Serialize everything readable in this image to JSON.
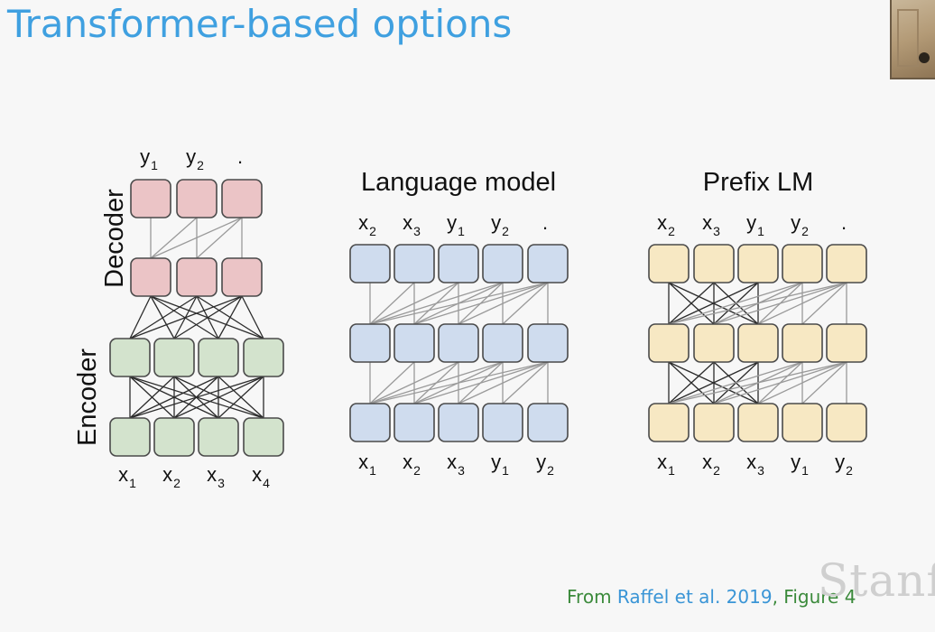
{
  "slide": {
    "title": "Transformer-based options"
  },
  "encoder_decoder": {
    "decoder_label": "Decoder",
    "encoder_label": "Encoder",
    "outputs": [
      {
        "base": "y",
        "sub": "1"
      },
      {
        "base": "y",
        "sub": "2"
      },
      {
        "base": ".",
        "sub": ""
      }
    ],
    "inputs": [
      {
        "base": "x",
        "sub": "1"
      },
      {
        "base": "x",
        "sub": "2"
      },
      {
        "base": "x",
        "sub": "3"
      },
      {
        "base": "x",
        "sub": "4"
      }
    ],
    "colors": {
      "decoder": "#ebc4c6",
      "encoder": "#d3e3cd"
    }
  },
  "language_model": {
    "title": "Language model",
    "outputs": [
      {
        "base": "x",
        "sub": "2"
      },
      {
        "base": "x",
        "sub": "3"
      },
      {
        "base": "y",
        "sub": "1"
      },
      {
        "base": "y",
        "sub": "2"
      },
      {
        "base": ".",
        "sub": ""
      }
    ],
    "inputs": [
      {
        "base": "x",
        "sub": "1"
      },
      {
        "base": "x",
        "sub": "2"
      },
      {
        "base": "x",
        "sub": "3"
      },
      {
        "base": "y",
        "sub": "1"
      },
      {
        "base": "y",
        "sub": "2"
      }
    ],
    "color": "#cfdcee"
  },
  "prefix_lm": {
    "title": "Prefix LM",
    "outputs": [
      {
        "base": "x",
        "sub": "2"
      },
      {
        "base": "x",
        "sub": "3"
      },
      {
        "base": "y",
        "sub": "1"
      },
      {
        "base": "y",
        "sub": "2"
      },
      {
        "base": ".",
        "sub": ""
      }
    ],
    "inputs": [
      {
        "base": "x",
        "sub": "1"
      },
      {
        "base": "x",
        "sub": "2"
      },
      {
        "base": "x",
        "sub": "3"
      },
      {
        "base": "y",
        "sub": "1"
      },
      {
        "base": "y",
        "sub": "2"
      }
    ],
    "color": "#f7e8c3"
  },
  "citation": {
    "prefix": "From ",
    "link": "Raffel et al. 2019",
    "separator": ", ",
    "figure": "Figure 4"
  },
  "watermark": "Stanfo"
}
